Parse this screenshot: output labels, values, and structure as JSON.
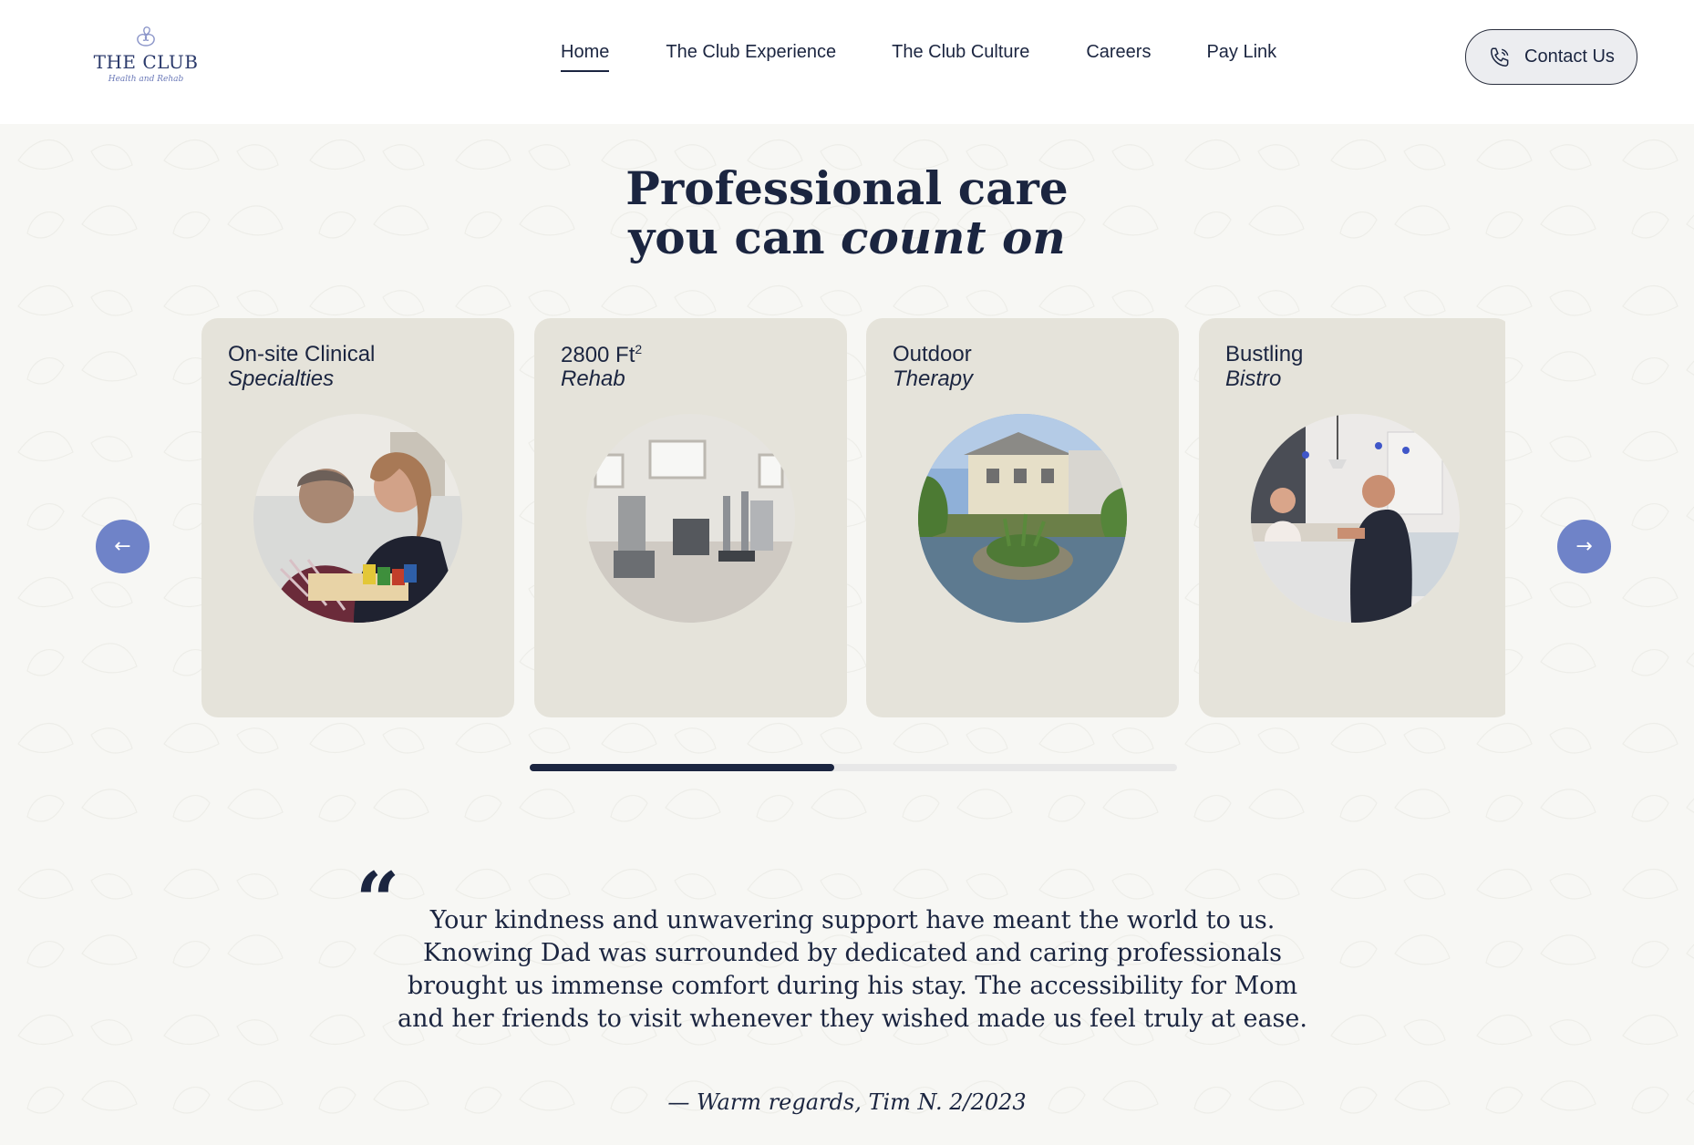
{
  "header": {
    "logo": {
      "name": "THE CLUB",
      "tagline": "Health and Rehab"
    },
    "nav": [
      {
        "label": "Home",
        "active": true
      },
      {
        "label": "The Club Experience",
        "active": false
      },
      {
        "label": "The Club Culture",
        "active": false
      },
      {
        "label": "Careers",
        "active": false
      },
      {
        "label": "Pay Link",
        "active": false
      }
    ],
    "contact": {
      "label": "Contact Us",
      "icon": "phone-icon"
    }
  },
  "hero": {
    "line1": "Professional care",
    "line2_prefix": "you can ",
    "line2_emphasis": "count on"
  },
  "carousel": {
    "prev_icon": "←",
    "next_icon": "→",
    "progress": 0.47,
    "cards": [
      {
        "line1": "On-site Clinical",
        "line2": "Specialties",
        "image": "caregiver-with-resident-photo"
      },
      {
        "line1": "2800 Ft",
        "superscript": "2",
        "line2": "Rehab",
        "image": "rehab-gym-photo"
      },
      {
        "line1": "Outdoor",
        "line2": "Therapy",
        "image": "courtyard-pond-photo"
      },
      {
        "line1": "Bustling",
        "line2": "Bistro",
        "image": "bistro-counter-photo"
      }
    ]
  },
  "testimonial": {
    "quote_mark": "“",
    "text": "Your kindness and unwavering support have meant the world to us. Knowing Dad was surrounded by dedicated and caring professionals brought us immense comfort during his stay. The accessibility for Mom and her friends to visit whenever they wished made us feel truly at ease.",
    "attribution": "— Warm regards, Tim N. 2/2023"
  },
  "colors": {
    "navy": "#1b2540",
    "card": "#e5e3da",
    "arrow": "#6f83c8"
  }
}
